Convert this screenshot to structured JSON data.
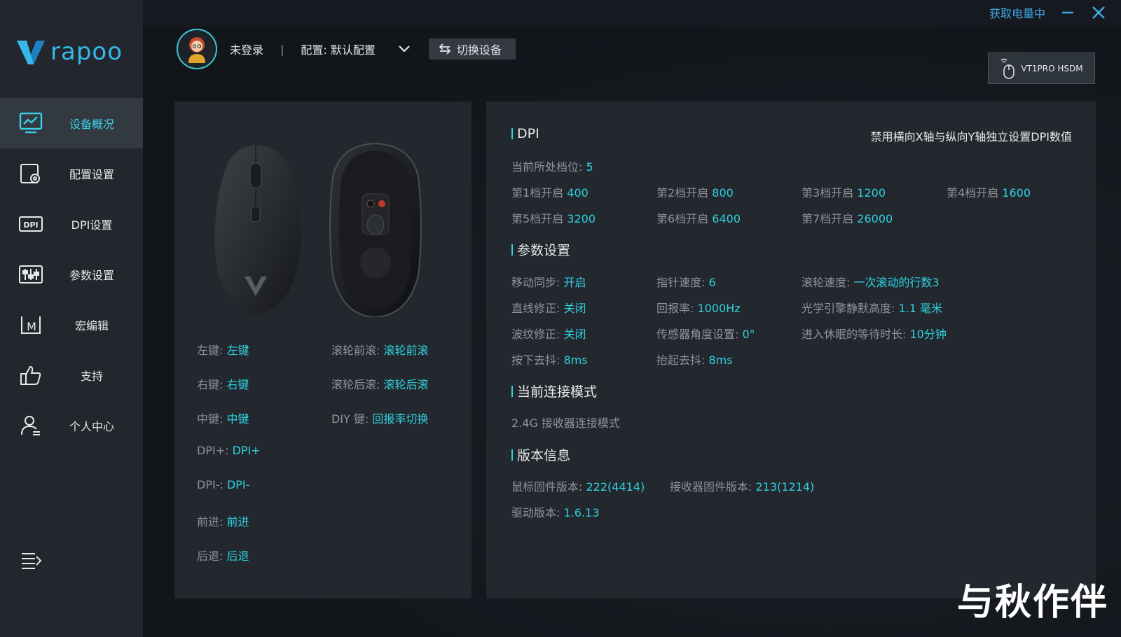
{
  "app": {
    "brand": "rapoo"
  },
  "titlebar": {
    "power_status": "获取电量中"
  },
  "sidebar": {
    "items": [
      {
        "label": "设备概况",
        "icon": "monitor-chart-icon"
      },
      {
        "label": "配置设置",
        "icon": "config-gear-icon"
      },
      {
        "label": "DPI设置",
        "icon": "dpi-icon"
      },
      {
        "label": "参数设置",
        "icon": "sliders-icon"
      },
      {
        "label": "宏编辑",
        "icon": "macro-m-icon"
      },
      {
        "label": "支持",
        "icon": "thumbs-up-icon"
      },
      {
        "label": "个人中心",
        "icon": "user-icon"
      }
    ],
    "active_index": 0
  },
  "userbar": {
    "login_status": "未登录",
    "separator": "|",
    "config_label": "配置: 默认配置",
    "switch_device": "切换设备"
  },
  "device": {
    "name": "VT1PRO HSDM"
  },
  "buttons": {
    "left": {
      "k": "左键:",
      "v": "左键"
    },
    "right": {
      "k": "右键:",
      "v": "右键"
    },
    "middle": {
      "k": "中键:",
      "v": "中键"
    },
    "dpi_plus": {
      "k": "DPI+:",
      "v": "DPI+"
    },
    "dpi_minus": {
      "k": "DPI-:",
      "v": "DPI-"
    },
    "forward": {
      "k": "前进:",
      "v": "前进"
    },
    "back": {
      "k": "后退:",
      "v": "后退"
    },
    "scroll_up": {
      "k": "滚轮前滚:",
      "v": "滚轮前滚"
    },
    "scroll_down": {
      "k": "滚轮后滚:",
      "v": "滚轮后滚"
    },
    "diy": {
      "k": "DIY 键:",
      "v": "回报率切换"
    }
  },
  "dpi": {
    "title": "DPI",
    "note": "禁用横向X轴与纵向Y轴独立设置DPI数值",
    "current": {
      "k": "当前所处档位:",
      "v": "5"
    },
    "levels": [
      {
        "k": "第1档开启",
        "v": "400"
      },
      {
        "k": "第2档开启",
        "v": "800"
      },
      {
        "k": "第3档开启",
        "v": "1200"
      },
      {
        "k": "第4档开启",
        "v": "1600"
      },
      {
        "k": "第5档开启",
        "v": "3200"
      },
      {
        "k": "第6档开启",
        "v": "6400"
      },
      {
        "k": "第7档开启",
        "v": "26000"
      }
    ]
  },
  "params": {
    "title": "参数设置",
    "items": [
      {
        "k": "移动同步:",
        "v": "开启"
      },
      {
        "k": "指针速度:",
        "v": "6"
      },
      {
        "k": "滚轮速度:",
        "v": "一次滚动的行数3"
      },
      {
        "k": "直线修正:",
        "v": "关闭"
      },
      {
        "k": "回报率:",
        "v": "1000Hz"
      },
      {
        "k": "光学引擎静默高度:",
        "v": "1.1 毫米"
      },
      {
        "k": "波纹修正:",
        "v": "关闭"
      },
      {
        "k": "传感器角度设置:",
        "v": "0°"
      },
      {
        "k": "进入休眠的等待时长:",
        "v": "10分钟"
      },
      {
        "k": "按下去抖:",
        "v": "8ms"
      },
      {
        "k": "抬起去抖:",
        "v": "8ms"
      }
    ]
  },
  "connection": {
    "title": "当前连接模式",
    "mode": "2.4G 接收器连接模式"
  },
  "version": {
    "title": "版本信息",
    "mouse_fw": {
      "k": "鼠标固件版本:",
      "v": "222(4414)"
    },
    "receiver_fw": {
      "k": "接收器固件版本:",
      "v": "213(1214)"
    },
    "driver": {
      "k": "驱动版本:",
      "v": "1.6.13"
    }
  },
  "watermark": "与秋作伴",
  "colors": {
    "accent": "#2fd2e2",
    "brand": "#36b8e8",
    "sidebar": "#23272d",
    "panel": "#23282e"
  }
}
